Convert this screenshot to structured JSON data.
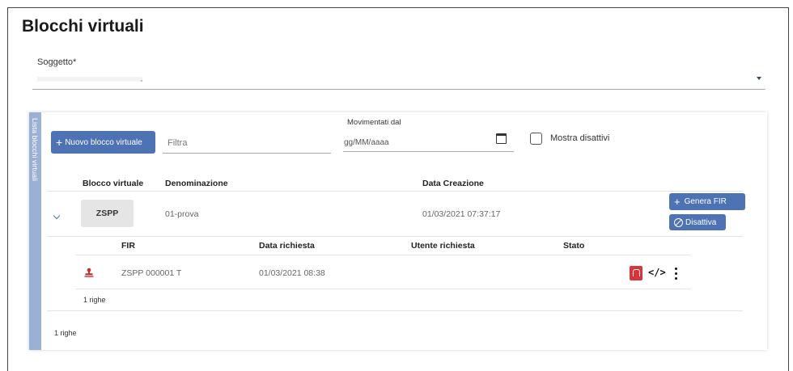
{
  "page": {
    "title": "Blocchi virtuali"
  },
  "subject": {
    "label": "Soggetto*"
  },
  "panel": {
    "side_tab": "Lista blocchi virtuali",
    "new_button": "Nuovo blocco virtuale",
    "filter_placeholder": "Filtra",
    "moved_since_label": "Movimentati dal",
    "date_placeholder": "gg/MM/aaaa",
    "show_disabled_label": "Mostra disattivi",
    "show_disabled_checked": false,
    "columns": [
      "Blocco virtuale",
      "Denominazione",
      "Data Creazione"
    ],
    "rows": [
      {
        "code": "ZSPP",
        "name": "01-prova",
        "created": "01/03/2021 07:37:17",
        "actions": {
          "generate": "Genera FIR",
          "disable": "Disattiva"
        },
        "sub_columns": [
          "FIR",
          "Data richiesta",
          "Utente richiesta",
          "Stato"
        ],
        "sub_rows": [
          {
            "fir": "ZSPP 000001 T",
            "requested": "01/03/2021 08:38",
            "user": "",
            "status": ""
          }
        ],
        "sub_count": "1 righe"
      }
    ],
    "count": "1 righe"
  },
  "icons": {
    "chevron": "chevron-down-icon",
    "stamp": "stamp-icon",
    "pdf": "pdf-icon",
    "code": "code-icon",
    "more": "more-vertical-icon",
    "calendar": "calendar-icon"
  },
  "colors": {
    "accent": "#4d73b4",
    "side_tab": "#9ab0d4",
    "pdf": "#d8363b",
    "stamp": "#c9302c"
  }
}
